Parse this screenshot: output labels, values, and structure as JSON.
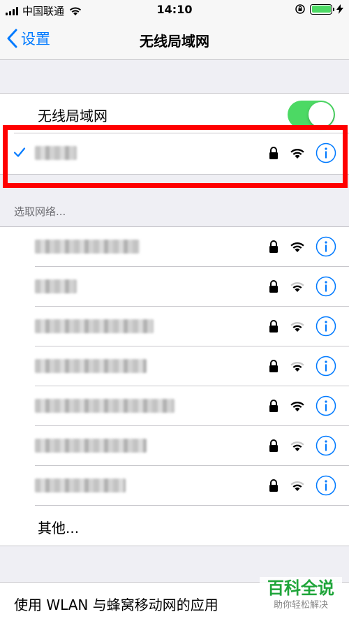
{
  "status_bar": {
    "carrier": "中国联通",
    "time": "14:10"
  },
  "nav": {
    "back_label": "设置",
    "title": "无线局域网"
  },
  "wlan_toggle": {
    "label": "无线局域网",
    "on": true
  },
  "connected_network": {
    "connected": true,
    "secured": true,
    "signal": "strong"
  },
  "choose_network": {
    "header": "选取网络...",
    "networks": [
      {
        "secured": true,
        "signal": "strong"
      },
      {
        "secured": true,
        "signal": "medium"
      },
      {
        "secured": true,
        "signal": "medium"
      },
      {
        "secured": true,
        "signal": "medium"
      },
      {
        "secured": true,
        "signal": "strong"
      },
      {
        "secured": true,
        "signal": "medium"
      },
      {
        "secured": true,
        "signal": "medium"
      }
    ],
    "other_label": "其他..."
  },
  "bottom": {
    "apps_label": "使用 WLAN 与蜂窝移动网的应用"
  },
  "watermark": {
    "title": "百科全说",
    "subtitle": "助你轻松解决"
  },
  "colors": {
    "accent": "#007aff",
    "toggle_on": "#4cd964",
    "highlight": "#ff0000",
    "watermark": "#1fa53a"
  }
}
